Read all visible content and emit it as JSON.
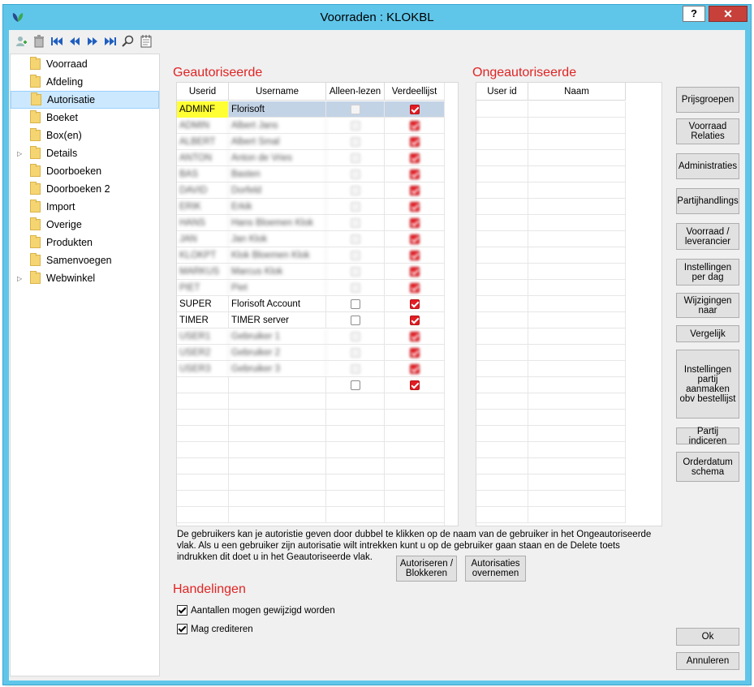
{
  "window": {
    "title": "Voorraden : KLOKBL",
    "help_label": "?",
    "close_label": "✕"
  },
  "toolbar": {
    "icons": [
      "add-user-icon",
      "trash-icon",
      "first-record-icon",
      "previous-record-icon",
      "next-record-icon",
      "last-record-icon",
      "search-icon",
      "notes-icon"
    ]
  },
  "tree": {
    "items": [
      {
        "label": "Voorraad",
        "expandable": false
      },
      {
        "label": "Afdeling",
        "expandable": false
      },
      {
        "label": "Autorisatie",
        "expandable": false,
        "selected": true
      },
      {
        "label": "Boeket",
        "expandable": false
      },
      {
        "label": "Box(en)",
        "expandable": false
      },
      {
        "label": "Details",
        "expandable": true
      },
      {
        "label": "Doorboeken",
        "expandable": false
      },
      {
        "label": "Doorboeken 2",
        "expandable": false
      },
      {
        "label": "Import",
        "expandable": false
      },
      {
        "label": "Overige",
        "expandable": false
      },
      {
        "label": "Produkten",
        "expandable": false
      },
      {
        "label": "Samenvoegen",
        "expandable": false
      },
      {
        "label": "Webwinkel",
        "expandable": true
      }
    ]
  },
  "authorized": {
    "title": "Geautoriseerde",
    "columns": [
      "Userid",
      "Username",
      "Alleen-lezen",
      "Verdeellijst"
    ],
    "rows": [
      {
        "userid": "ADMINF",
        "username": "Florisoft",
        "readonly": false,
        "verdeellijst": true,
        "selected": true,
        "blurred": false
      },
      {
        "userid": "ADMIN",
        "username": "Albert Jans",
        "readonly": false,
        "verdeellijst": true,
        "blurred": true
      },
      {
        "userid": "ALBERT",
        "username": "Albert Smal",
        "readonly": false,
        "verdeellijst": true,
        "blurred": true
      },
      {
        "userid": "ANTON",
        "username": "Anton de Vries",
        "readonly": false,
        "verdeellijst": true,
        "blurred": true
      },
      {
        "userid": "BAS",
        "username": "Basten",
        "readonly": false,
        "verdeellijst": true,
        "blurred": true
      },
      {
        "userid": "DAVID",
        "username": "Dorfeld",
        "readonly": false,
        "verdeellijst": true,
        "blurred": true
      },
      {
        "userid": "ERIK",
        "username": "Erkik",
        "readonly": false,
        "verdeellijst": true,
        "blurred": true
      },
      {
        "userid": "HANS",
        "username": "Hans Bloemen Klok",
        "readonly": false,
        "verdeellijst": true,
        "blurred": true
      },
      {
        "userid": "JAN",
        "username": "Jan Klok",
        "readonly": false,
        "verdeellijst": true,
        "blurred": true
      },
      {
        "userid": "KLOKPT",
        "username": "Klok Bloemen Klok",
        "readonly": false,
        "verdeellijst": true,
        "blurred": true
      },
      {
        "userid": "MARKUS",
        "username": "Marcus Klok",
        "readonly": false,
        "verdeellijst": true,
        "blurred": true
      },
      {
        "userid": "PIET",
        "username": "Piet",
        "readonly": false,
        "verdeellijst": true,
        "blurred": true
      },
      {
        "userid": "SUPER",
        "username": "Florisoft Account",
        "readonly": false,
        "verdeellijst": true,
        "blurred": false
      },
      {
        "userid": "TIMER",
        "username": "TIMER server",
        "readonly": false,
        "verdeellijst": true,
        "blurred": false
      },
      {
        "userid": "USER1",
        "username": "Gebruiker 1",
        "readonly": false,
        "verdeellijst": true,
        "blurred": true
      },
      {
        "userid": "USER2",
        "username": "Gebruiker 2",
        "readonly": false,
        "verdeellijst": true,
        "blurred": true
      },
      {
        "userid": "USER3",
        "username": "Gebruiker 3",
        "readonly": false,
        "verdeellijst": true,
        "blurred": true
      },
      {
        "userid": "",
        "username": "",
        "readonly": false,
        "verdeellijst": true,
        "blurred": false
      }
    ]
  },
  "unauthorized": {
    "title": "Ongeautoriseerde",
    "columns": [
      "User id",
      "Naam"
    ]
  },
  "side_buttons": [
    "Prijsgroepen",
    "Voorraad Relaties",
    "Administraties",
    "Partijhandlings",
    "Voorraad / leverancier",
    "Instellingen per dag",
    "Wijzigingen naar",
    "Vergelijk",
    "Instellingen partij aanmaken obv bestellijst",
    "Partij indiceren",
    "Orderdatum schema"
  ],
  "info_text": "De gebruikers kan je autoristie geven door dubbel te klikken op de naam van de gebruiker in het Ongeautoriseerde vlak. Als u een gebruiker zijn autorisatie wilt intrekken kunt u op de gebruiker gaan staan en de Delete toets indrukken dit doet u in het Geautoriseerde vlak.",
  "actions": {
    "authorize_label": "Autoriseren / Blokkeren",
    "copy_label": "Autorisaties overnemen"
  },
  "handelingen": {
    "title": "Handelingen",
    "options": [
      {
        "label": "Aantallen mogen gewijzigd worden",
        "checked": true
      },
      {
        "label": "Mag crediteren",
        "checked": true
      }
    ]
  },
  "footer": {
    "ok_label": "Ok",
    "cancel_label": "Annuleren"
  },
  "colors": {
    "titlebar": "#5fc6ea",
    "accent_red": "#e02424",
    "checkbox_red": "#e31b23",
    "selected_row": "#c3d3e6",
    "highlight_yellow": "#ffff33"
  }
}
